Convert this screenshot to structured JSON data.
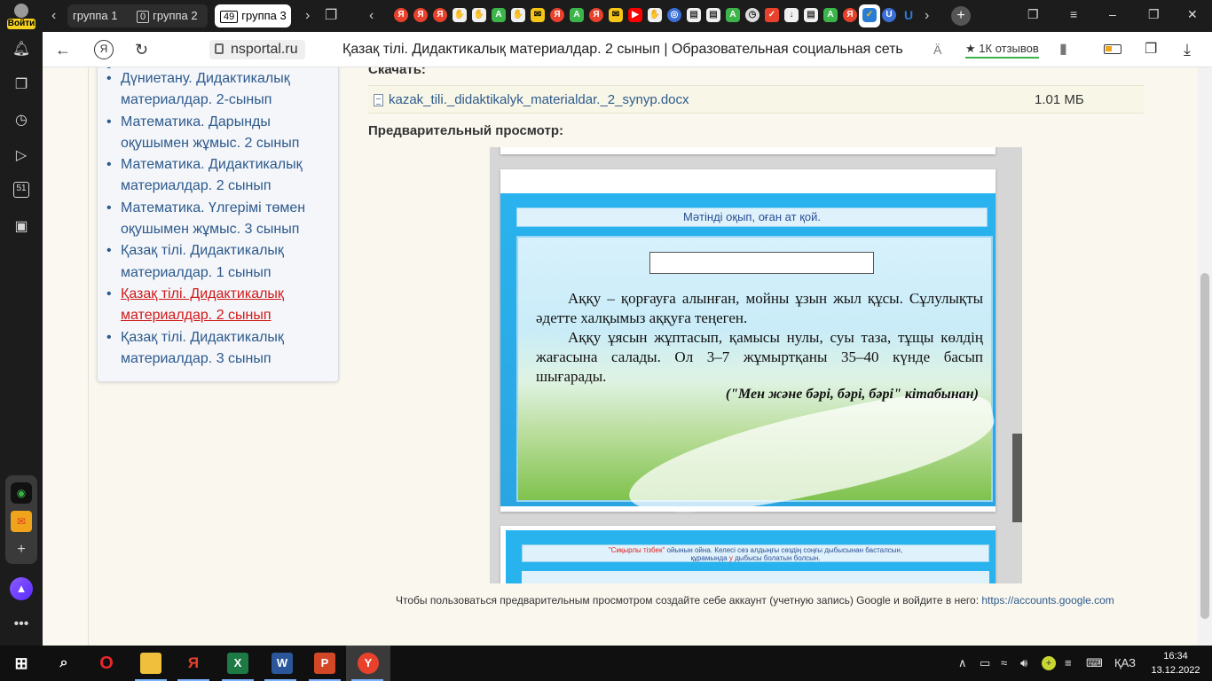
{
  "sidebar": {
    "login_label": "Войти",
    "counter_badge": "51"
  },
  "tabs": {
    "group1": "группа 1",
    "group2_count": "0",
    "group2": "группа 2",
    "group3_count": "49",
    "group3": "группа 3"
  },
  "favicons": [
    "Я",
    "Я",
    "Я",
    "",
    "",
    "А",
    "",
    "",
    "Я",
    "А",
    "Я",
    "",
    "",
    "",
    "",
    "",
    "А",
    "",
    "",
    "Я",
    "А",
    "Я",
    "",
    "",
    "U",
    ""
  ],
  "address": {
    "domain": "nsportal.ru",
    "page_title": "Қазақ тілі. Дидактикалық материалдар. 2 сынып | Образовательная социальная сеть",
    "reviews": "1К отзывов"
  },
  "nav_list": {
    "items": [
      "Дүниетану. Дидактикалық материалдар. 2-сынып",
      "Математика. Дарынды оқушымен жұмыс. 2 сынып",
      "Математика. Дидактикалық материалдар. 2 сынып",
      "Математика. Үлгерімі төмен оқушымен жұмыс. 3 сынып",
      "Қазақ тілі. Дидактикалық материалдар. 1 сынып",
      "Қазақ тілі. Дидактикалық материалдар. 2 сынып",
      "Қазақ тілі. Дидактикалық материалдар. 3 сынып"
    ],
    "active_index": 5
  },
  "download": {
    "label": "Скачать:",
    "filename": "kazak_tili._didaktikalyk_materialdar._2_synyp.docx",
    "size": "1.01 МБ"
  },
  "preview": {
    "label": "Предварительный просмотр:",
    "banner": "Мәтінді оқып, оған ат қой.",
    "paragraph1": "Аққу – қорғауға алынған, мойны ұзын жыл құсы. Сұлулықты әдетте халқымыз аққуға теңеген.",
    "paragraph2": "Аққу ұясын жұптасып, қамысы нулы, суы таза, тұщы көлдің жағасына салады. Ол 3–7 жұмыртқаны 35–40 күнде басып шығарады.",
    "source": "(\"Мен және бәрі, бәрі, бәрі\" кітабынан)",
    "next_task_red": "\"Сиқырлы тізбек\"",
    "next_task_text": " ойынын ойна. Келесі сөз алдыңғы сөздің соңғы дыбысынан басталсын,",
    "next_task_line2_a": "құрамында ",
    "next_task_u": "у",
    "next_task_line2_b": " дыбысы болатын болсын."
  },
  "google_note": {
    "text": "Чтобы пользоваться предварительным просмотром создайте себе аккаунт (учетную запись) Google и войдите в него: ",
    "link": "https://accounts.google.com"
  },
  "taskbar": {
    "language": "ҚАЗ",
    "time": "16:34",
    "date": "13.12.2022"
  },
  "colors": {
    "link": "#2d5a8c",
    "active_link": "#d11a1a",
    "preview_blue": "#29b3ee",
    "login_badge": "#f4d21f"
  },
  "icons": [
    "person-icon",
    "bell-icon",
    "tabs-icon",
    "history-icon",
    "play-icon",
    "counter-icon",
    "screenshot-icon",
    "alice-icon",
    "mail-icon",
    "plus-icon",
    "more-icon",
    "back-icon",
    "yandex-icon",
    "reload-icon",
    "lock-icon",
    "translate-icon",
    "star-icon",
    "bookmark-icon",
    "battery-icon",
    "extensions-icon",
    "download-icon",
    "doc-icon",
    "windows-icon",
    "search-icon"
  ]
}
